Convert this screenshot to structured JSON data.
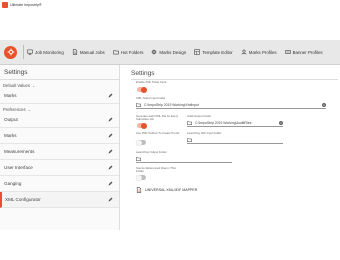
{
  "window": {
    "title": "Ultimate Impostrip®"
  },
  "toolbar": {
    "items": [
      {
        "label": "Job Monitoring",
        "icon": "monitor-icon"
      },
      {
        "label": "Manual Jobs",
        "icon": "document-icon"
      },
      {
        "label": "Hot Folders",
        "icon": "folder-icon"
      },
      {
        "label": "Marks Design",
        "icon": "crosshair-icon"
      },
      {
        "label": "Template Editor",
        "icon": "layout-icon"
      },
      {
        "label": "Marks Profiles",
        "icon": "user-icon"
      },
      {
        "label": "Banner Profiles",
        "icon": "banner-icon"
      }
    ]
  },
  "sidebar": {
    "title": "Settings",
    "groups": [
      {
        "label": "Default Values",
        "items": [
          "Marks"
        ]
      },
      {
        "label": "Preferences",
        "items": [
          "Output",
          "Marks",
          "Measurements",
          "User Interface",
          "Ganging",
          "XML Configurator"
        ]
      }
    ],
    "active": "XML Configurator"
  },
  "main": {
    "title": "Settings",
    "enable_label": "Enable XML Ticket Input",
    "ticket_folder_label": "XML Ticket Input Folder",
    "ticket_folder_value": "C:\\ImpoStrip 2019 Working\\XmlInput",
    "auditjob_label": "Generate audit XML File for Every Submitted Job",
    "audit_folder_label": "Audit Output Folder",
    "audit_folder_value": "C:\\ImpoStrip 2019 Working\\AuditFiles",
    "pdf_toolbox_label": "Use PDF Toolbox To Create Proofs",
    "jdf_folder_label": "Launching JDF Input Folder",
    "output_folder_label": "Launching Output Folder",
    "referenced_label": "Source Referenced Files in This Folder",
    "mapper_label": "UNIVERSAL XML/JDF MAPPER",
    "clear_glyph": "×"
  },
  "colors": {
    "accent": "#e8522a",
    "toolbar_bg": "#e8e8e8"
  }
}
